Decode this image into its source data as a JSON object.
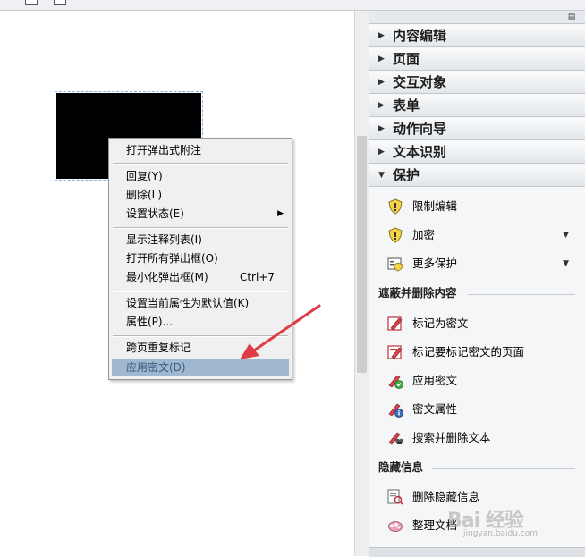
{
  "context_menu": {
    "items": [
      {
        "label": "打开弹出式附注"
      },
      {
        "label": "回复(Y)"
      },
      {
        "label": "删除(L)"
      },
      {
        "label": "设置状态(E)"
      },
      {
        "label": "显示注释列表(I)"
      },
      {
        "label": "打开所有弹出框(O)"
      },
      {
        "label": "最小化弹出框(M)",
        "shortcut": "Ctrl+7"
      },
      {
        "label": "设置当前属性为默认值(K)"
      },
      {
        "label": "属性(P)..."
      },
      {
        "label": "跨页重复标记"
      },
      {
        "label": "应用密文(D)"
      }
    ],
    "submenu_arrow": "▶"
  },
  "panel": {
    "sections": [
      {
        "label": "内容编辑",
        "expanded": false
      },
      {
        "label": "页面",
        "expanded": false
      },
      {
        "label": "交互对象",
        "expanded": false
      },
      {
        "label": "表单",
        "expanded": false
      },
      {
        "label": "动作向导",
        "expanded": false
      },
      {
        "label": "文本识别",
        "expanded": false
      },
      {
        "label": "保护",
        "expanded": true
      }
    ],
    "collapsed_marker": "▶",
    "expanded_marker": "▼",
    "dropdown_marker": "▼",
    "options_icon": "▤",
    "protect_tools": [
      {
        "label": "限制编辑",
        "icon": "shield-icon"
      },
      {
        "label": "加密",
        "icon": "shield-icon",
        "has_dropdown": true
      },
      {
        "label": "更多保护",
        "icon": "certificate-icon",
        "has_dropdown": true
      }
    ],
    "redact_heading": "遮蔽并删除内容",
    "redact_tools": [
      {
        "label": "标记为密文",
        "icon": "redact-mark-icon"
      },
      {
        "label": "标记要标记密文的页面",
        "icon": "redact-pages-icon"
      },
      {
        "label": "应用密文",
        "icon": "redact-apply-icon"
      },
      {
        "label": "密文属性",
        "icon": "redact-properties-icon"
      },
      {
        "label": "搜索并删除文本",
        "icon": "redact-search-icon"
      }
    ],
    "hidden_heading": "隐藏信息",
    "hidden_tools": [
      {
        "label": "删除隐藏信息",
        "icon": "remove-hidden-icon"
      },
      {
        "label": "整理文档",
        "icon": "sanitize-icon"
      }
    ]
  },
  "colors": {
    "highlight": "#9fb8cf",
    "arrow": "#e23a45",
    "panel_bg": "#f4f6f8"
  },
  "watermark": {
    "text": "Bai 经验",
    "subtext": "jingyan.baidu.com"
  }
}
